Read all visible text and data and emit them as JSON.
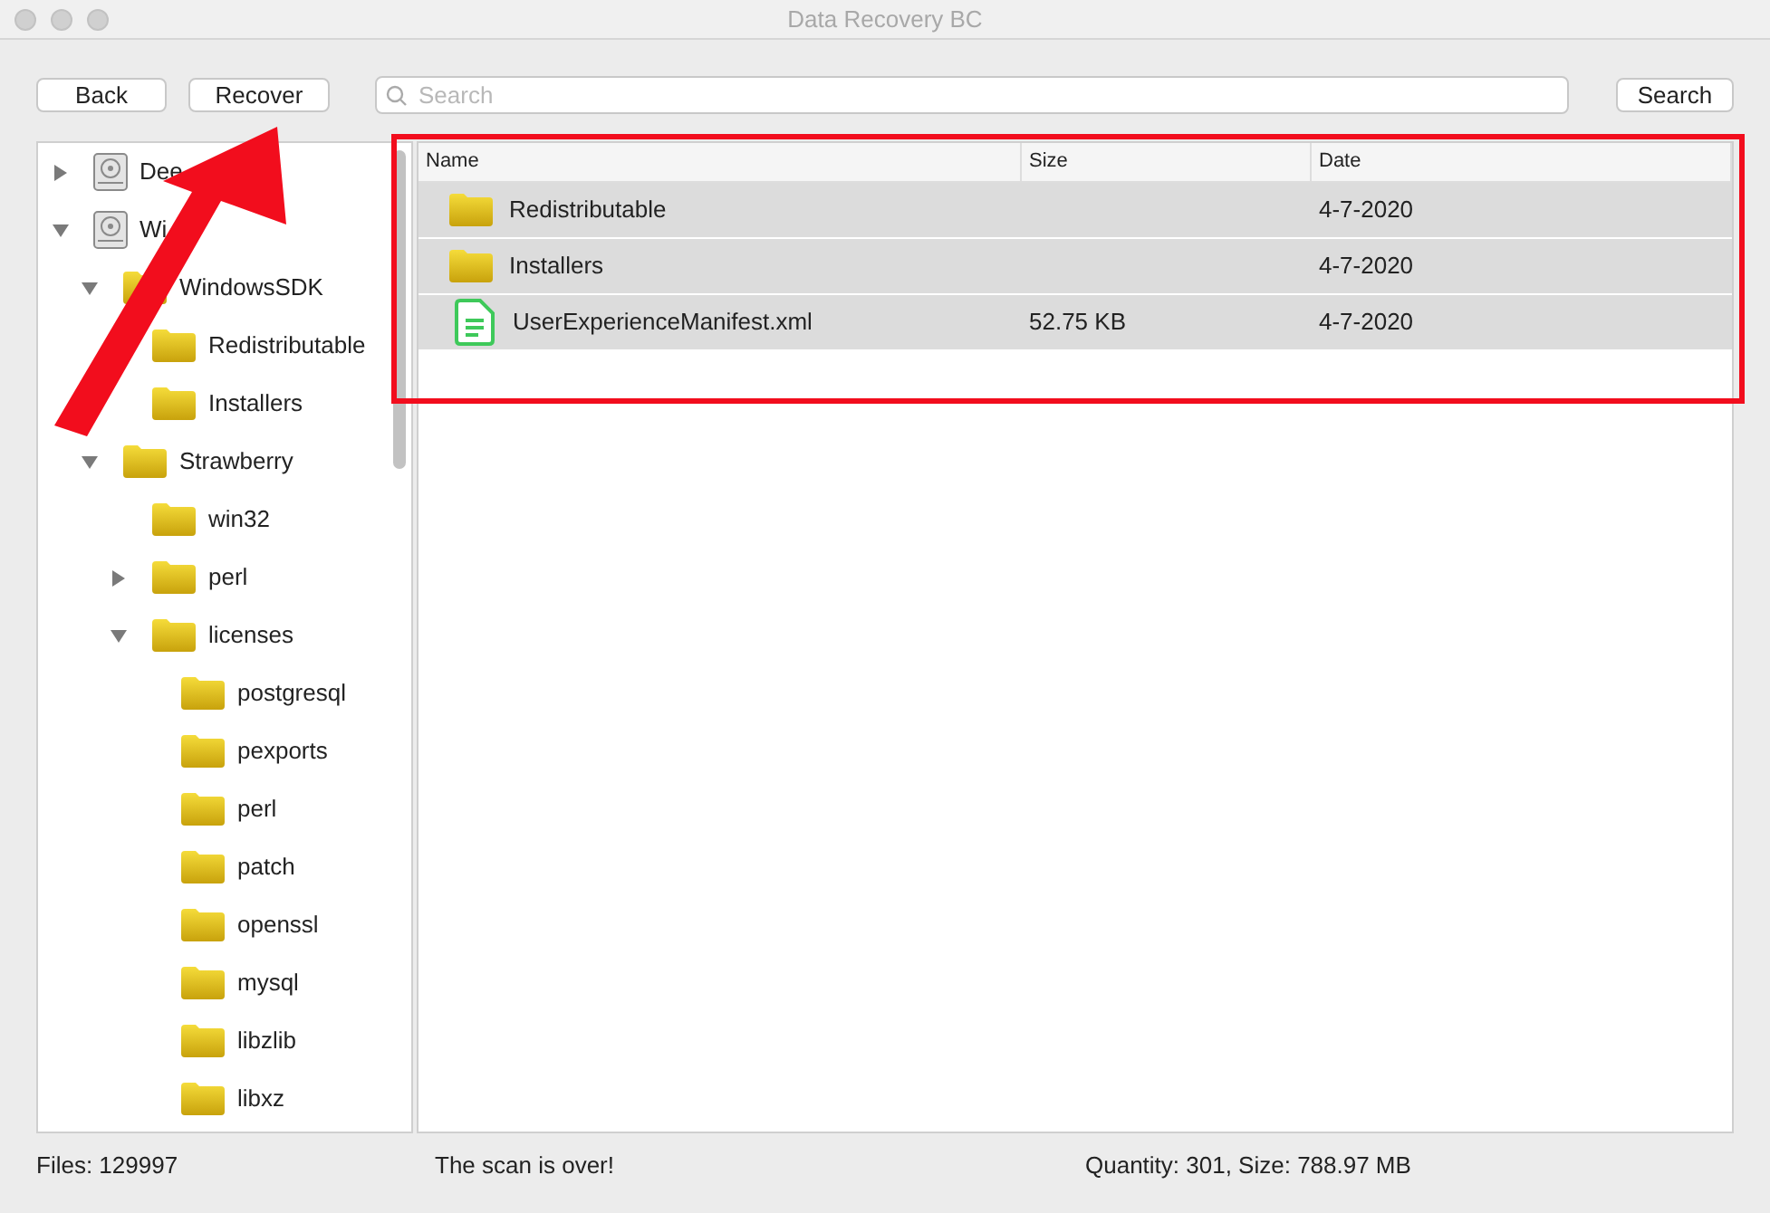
{
  "window": {
    "title": "Data Recovery BC"
  },
  "toolbar": {
    "buttons": [
      "Back",
      "Recover"
    ],
    "search": {
      "placeholder": "Search"
    },
    "search_button": "Search"
  },
  "tree": [
    {
      "label": "Dee",
      "kind": "disk",
      "expanded": false
    },
    {
      "label": "Wi",
      "kind": "disk",
      "expanded": true,
      "children": [
        {
          "label": "WindowsSDK",
          "kind": "folder",
          "expanded": true,
          "children": [
            {
              "label": "Redistributable",
              "kind": "folder"
            },
            {
              "label": "Installers",
              "kind": "folder"
            }
          ]
        },
        {
          "label": "Strawberry",
          "kind": "folder",
          "expanded": true,
          "children": [
            {
              "label": "win32",
              "kind": "folder"
            },
            {
              "label": "perl",
              "kind": "folder",
              "expanded": false
            },
            {
              "label": "licenses",
              "kind": "folder",
              "expanded": true,
              "children": [
                {
                  "label": "postgresql",
                  "kind": "folder"
                },
                {
                  "label": "pexports",
                  "kind": "folder"
                },
                {
                  "label": "perl",
                  "kind": "folder"
                },
                {
                  "label": "patch",
                  "kind": "folder"
                },
                {
                  "label": "openssl",
                  "kind": "folder"
                },
                {
                  "label": "mysql",
                  "kind": "folder"
                },
                {
                  "label": "libzlib",
                  "kind": "folder"
                },
                {
                  "label": "libxz",
                  "kind": "folder"
                }
              ]
            }
          ]
        }
      ]
    }
  ],
  "table": {
    "columns": [
      "Name",
      "Size",
      "Date"
    ],
    "rows": [
      {
        "kind": "folder",
        "name": "Redistributable",
        "size": "",
        "date": "4-7-2020"
      },
      {
        "kind": "folder",
        "name": "Installers",
        "size": "",
        "date": "4-7-2020"
      },
      {
        "kind": "file",
        "name": "UserExperienceManifest.xml",
        "size": "52.75 KB",
        "date": "4-7-2020"
      }
    ]
  },
  "status_bar": {
    "files": "Files:  129997",
    "message": "The scan is over!",
    "totals": "Quantity: 301,  Size: 788.97 MB"
  }
}
